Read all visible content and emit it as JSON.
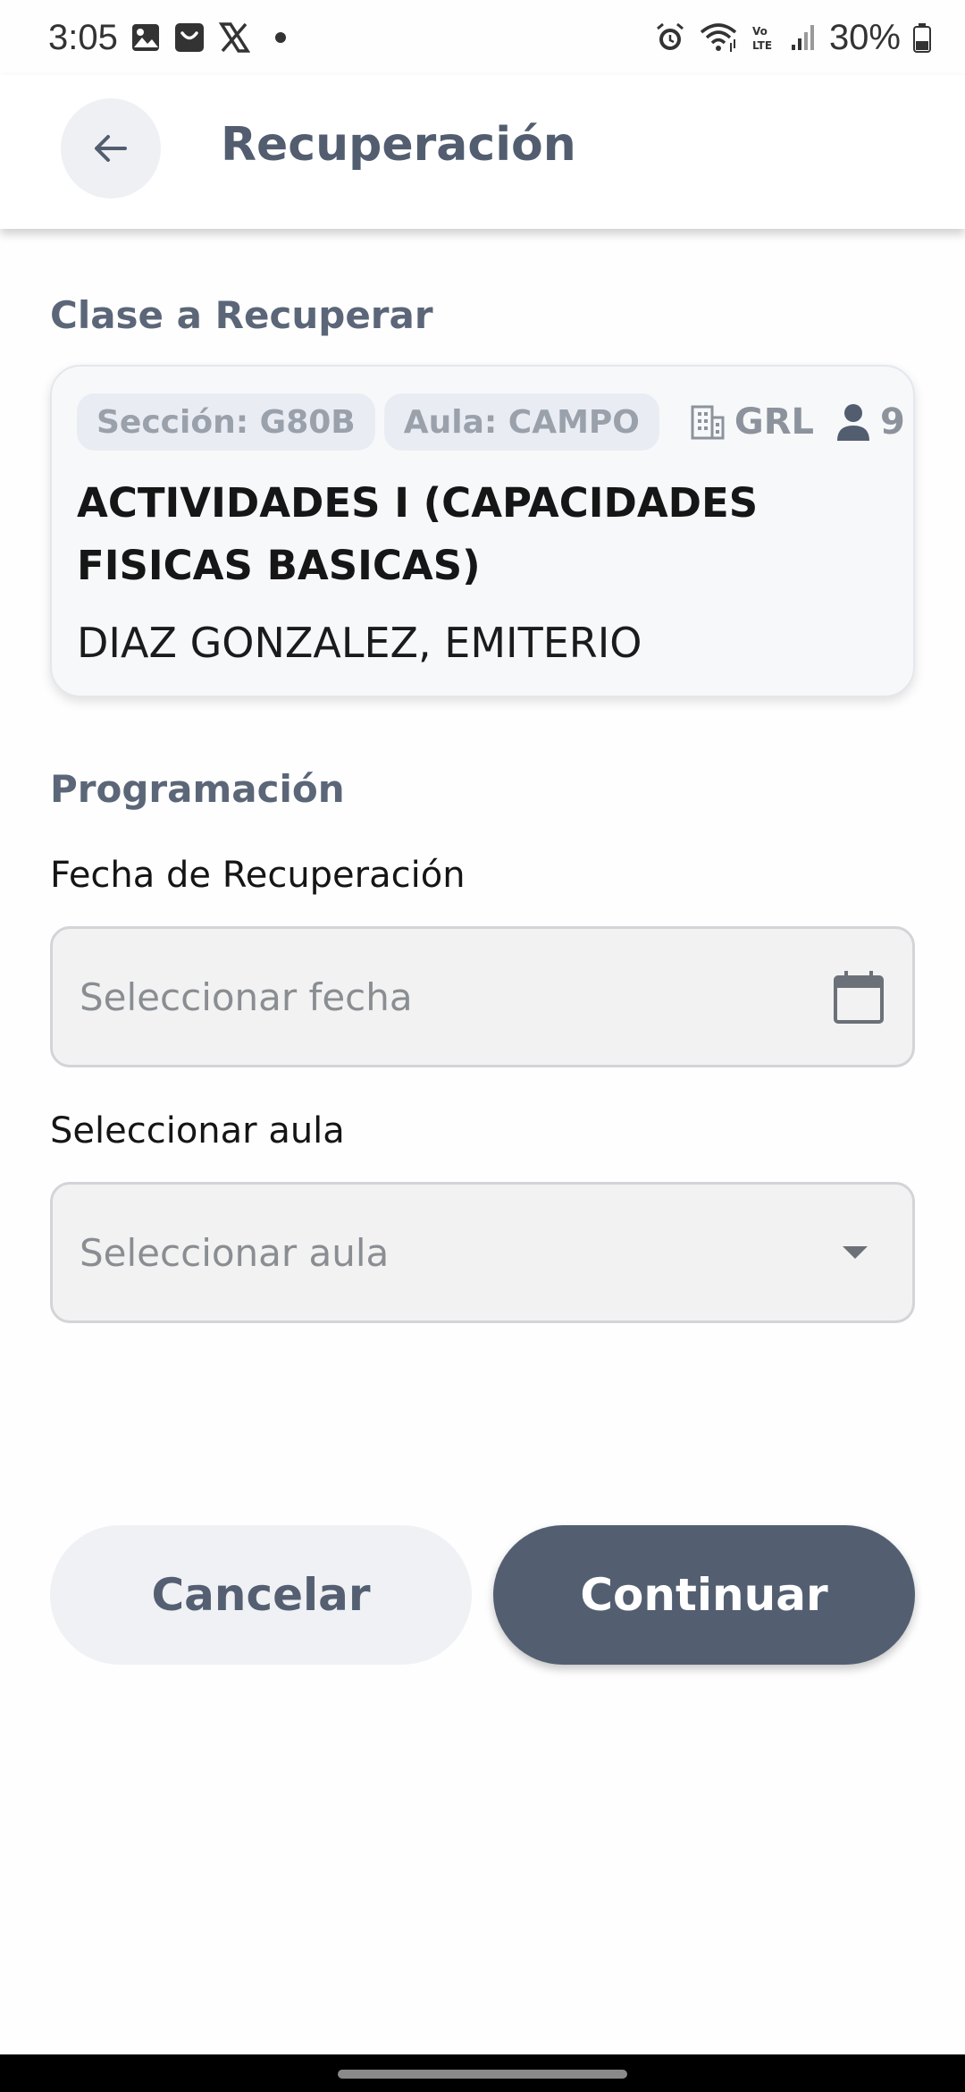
{
  "status_bar": {
    "time": "3:05",
    "battery": "30%",
    "icons": [
      "image-icon",
      "shop-icon",
      "x-logo-icon",
      "alarm-icon",
      "wifi-icon",
      "volte-icon",
      "signal-icon",
      "battery-icon"
    ]
  },
  "app_bar": {
    "title": "Recuperación",
    "back_icon": "arrow-left-icon"
  },
  "class_section": {
    "label": "Clase a Recuperar",
    "card": {
      "section_chip": "Sección: G80B",
      "room_chip": "Aula: CAMPO",
      "building": "GRL",
      "students": "9",
      "course": "ACTIVIDADES I (CAPACIDADES FISICAS BASICAS)",
      "teacher": "DIAZ GONZALEZ, EMITERIO"
    }
  },
  "schedule_section": {
    "label": "Programación",
    "date_field": {
      "label": "Fecha de Recuperación",
      "placeholder": "Seleccionar fecha",
      "icon": "calendar-icon"
    },
    "room_field": {
      "label": "Seleccionar aula",
      "placeholder": "Seleccionar aula",
      "icon": "dropdown-arrow-icon"
    }
  },
  "actions": {
    "cancel": "Cancelar",
    "continue": "Continuar"
  },
  "colors": {
    "primary": "#535f71",
    "title": "#525d70",
    "chip_bg": "#e9edf3",
    "field_bg": "#f2f2f2",
    "nav_bar": "#000000"
  }
}
